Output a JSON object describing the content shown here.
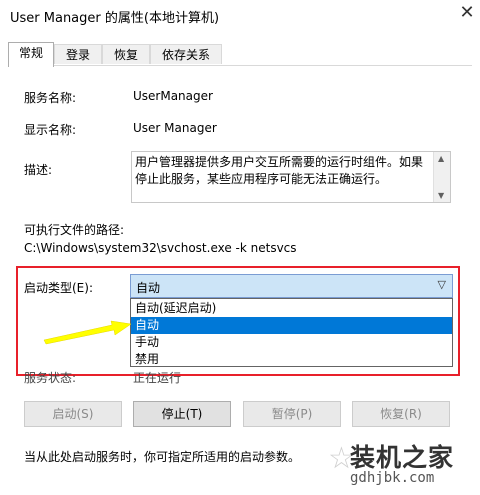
{
  "window": {
    "title": "User Manager 的属性(本地计算机)",
    "close_glyph": "✕"
  },
  "tabs": [
    {
      "label": "常规",
      "active": true
    },
    {
      "label": "登录",
      "active": false
    },
    {
      "label": "恢复",
      "active": false
    },
    {
      "label": "依存关系",
      "active": false
    }
  ],
  "general": {
    "service_name_label": "服务名称:",
    "service_name": "UserManager",
    "display_name_label": "显示名称:",
    "display_name": "User Manager",
    "description_label": "描述:",
    "description": "用户管理器提供多用户交互所需要的运行时组件。如果停止此服务，某些应用程序可能无法正确运行。",
    "path_label": "可执行文件的路径:",
    "path": "C:\\Windows\\system32\\svchost.exe -k netsvcs",
    "startup_type_label": "启动类型(E):",
    "startup_type_value": "自动",
    "startup_options": [
      "自动(延迟启动)",
      "自动",
      "手动",
      "禁用"
    ],
    "startup_selected_index": 1,
    "service_status_label": "服务状态:",
    "service_status": "正在运行"
  },
  "buttons": {
    "start": "启动(S)",
    "stop": "停止(T)",
    "pause": "暂停(P)",
    "resume": "恢复(R)"
  },
  "hint": "当从此处启动服务时，你可指定所适用的启动参数。",
  "watermark": {
    "main": "装机之家",
    "sub": "gdhjbk.com"
  },
  "colors": {
    "highlight_box": "#e8202a",
    "selected_item": "#0078d7",
    "arrow": "#ffff00"
  }
}
